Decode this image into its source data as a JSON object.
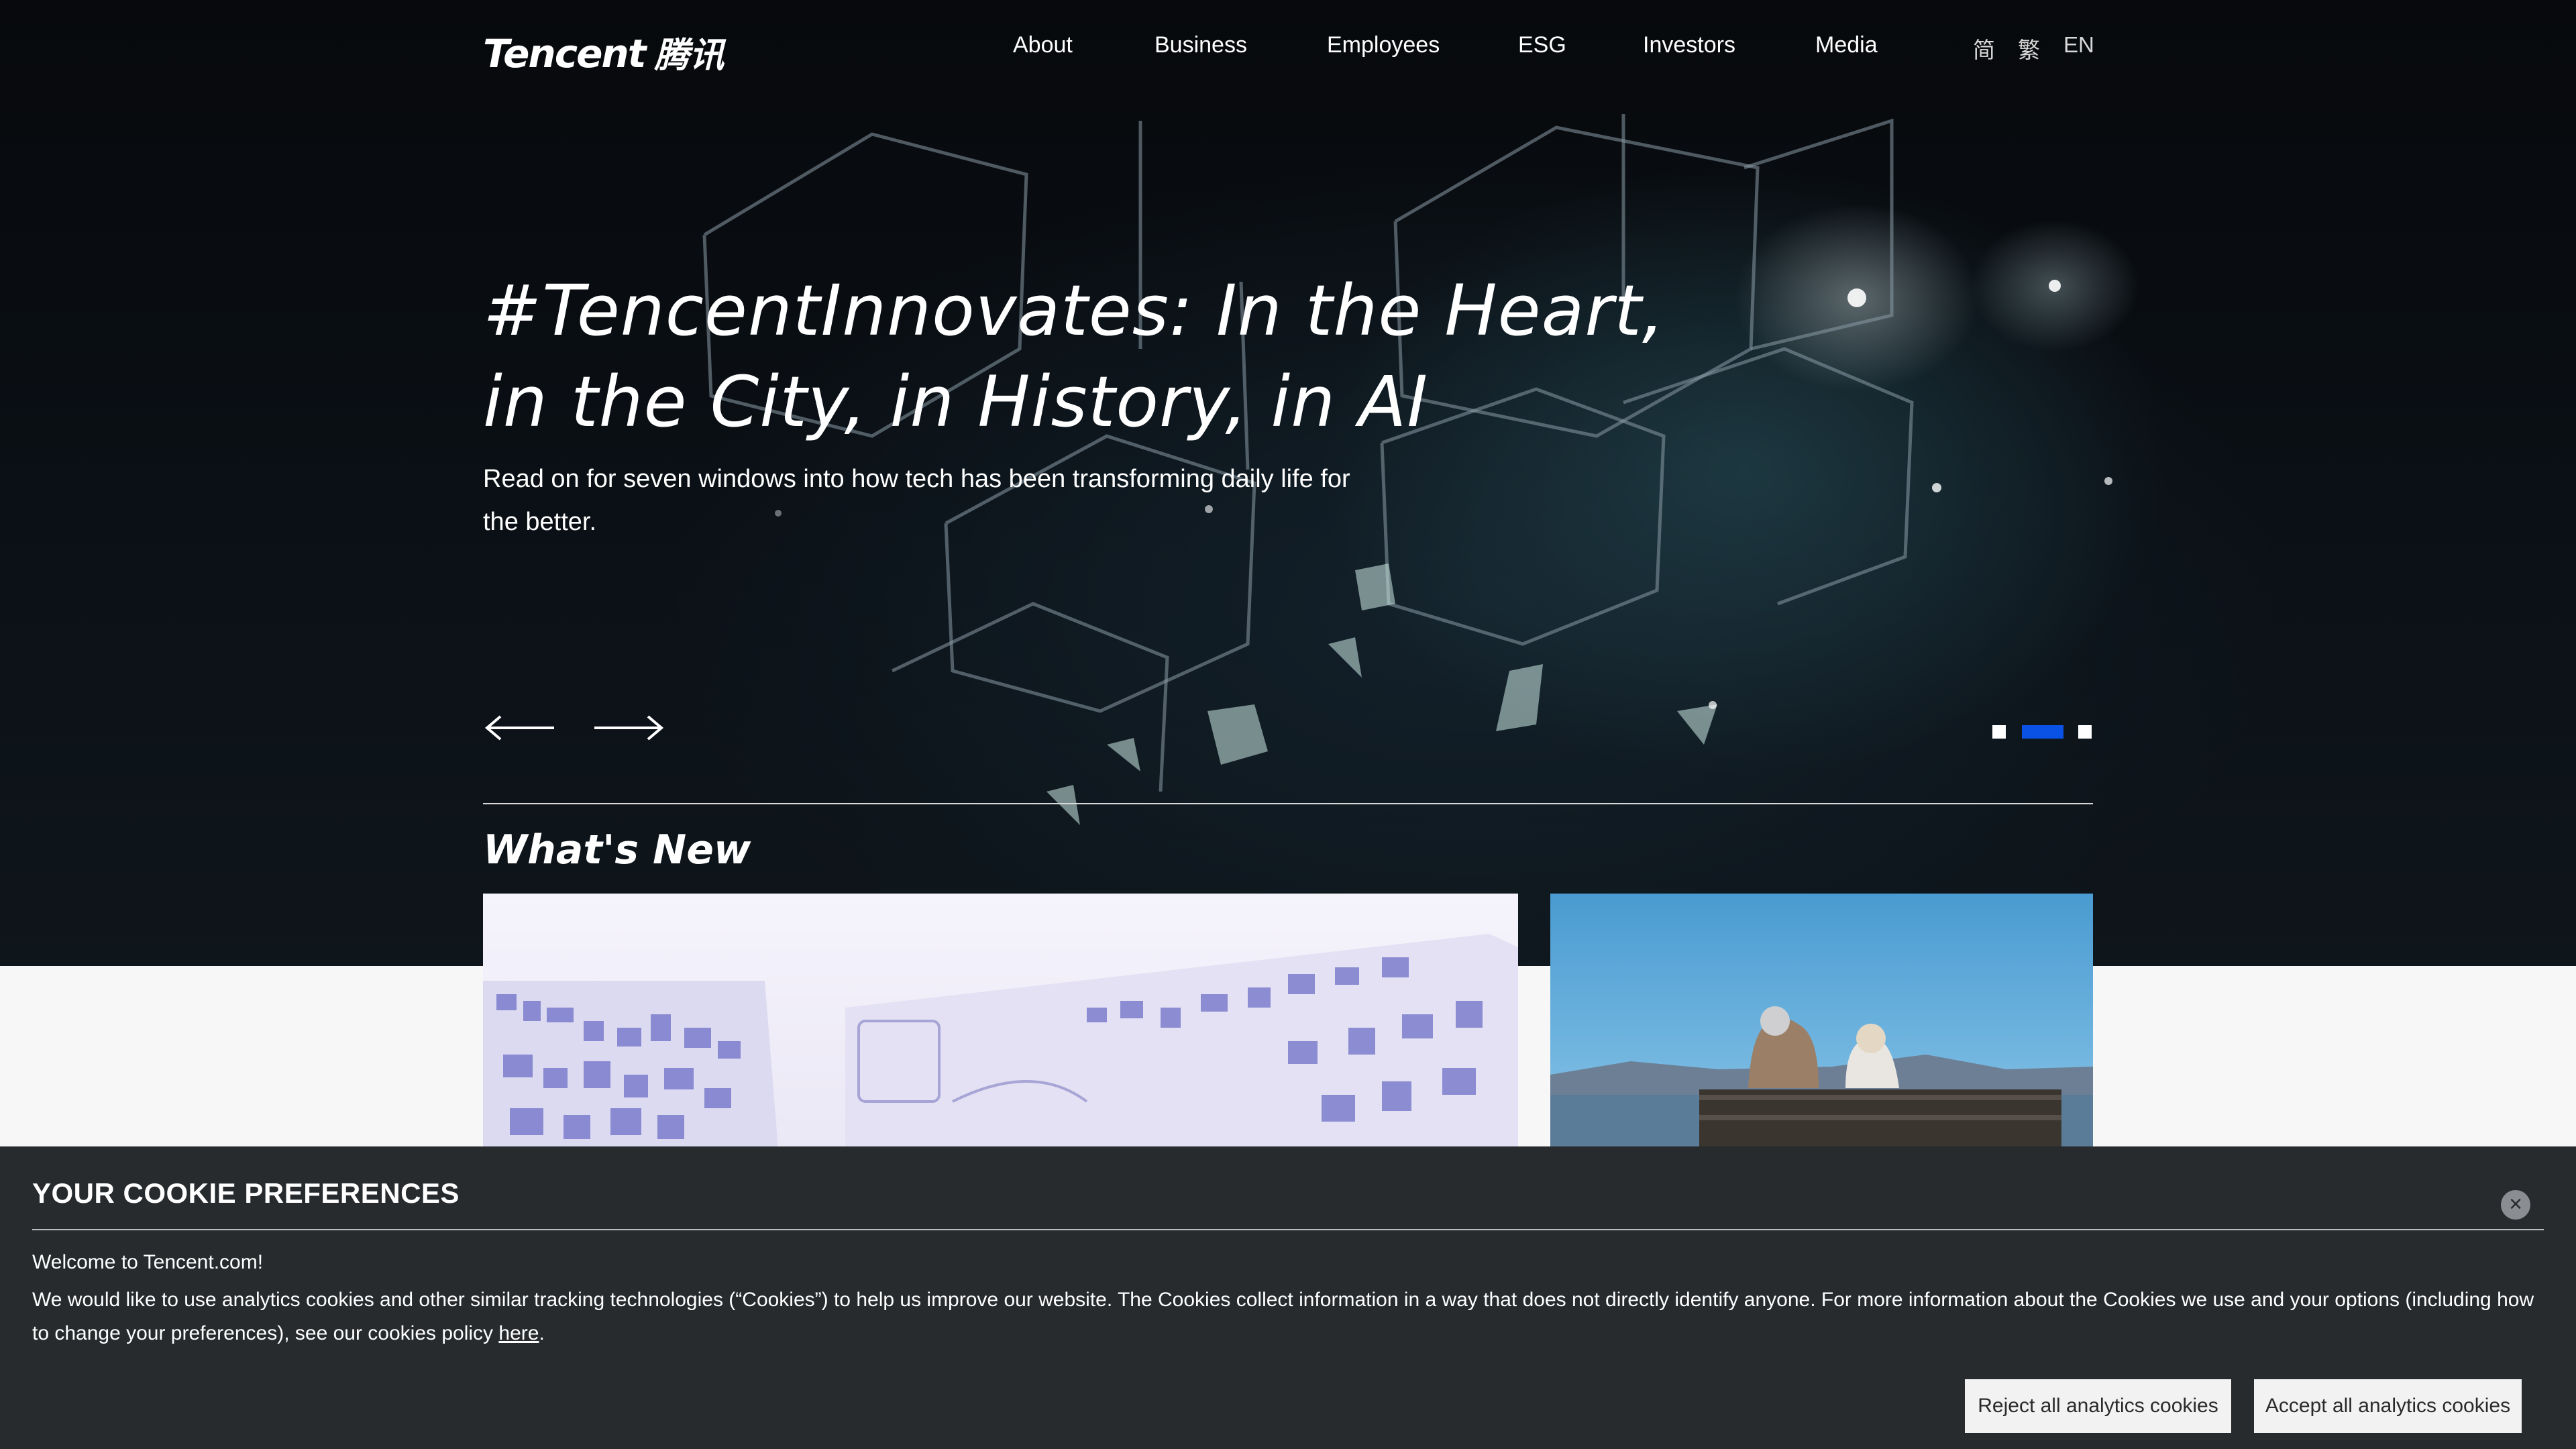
{
  "header": {
    "logo_en": "Tencent",
    "logo_zh": "腾讯",
    "nav": [
      {
        "label": "About"
      },
      {
        "label": "Business"
      },
      {
        "label": "Employees"
      },
      {
        "label": "ESG"
      },
      {
        "label": "Investors"
      },
      {
        "label": "Media"
      }
    ],
    "languages": [
      {
        "label": "简"
      },
      {
        "label": "繁"
      },
      {
        "label": "EN"
      }
    ]
  },
  "hero": {
    "headline": "#TencentInnovates: In the Heart, in the City, in History, in AI",
    "subline": "Read on for seven windows into how tech has been transforming daily life for the better.",
    "prev_icon": "arrow-left-icon",
    "next_icon": "arrow-right-icon",
    "slides_total": 3,
    "active_slide": 2,
    "accent_color": "#0a52e6"
  },
  "whats_new": {
    "title": "What's New"
  },
  "cookie_banner": {
    "title": "YOUR COOKIE PREFERENCES",
    "welcome": "Welcome to Tencent.com!",
    "text_before_link": "We would like to use analytics cookies and other similar tracking technologies (“Cookies”) to help us improve our website. The Cookies collect information in a way that does not directly identify anyone. For more information about the Cookies we use and your options (including how to change your preferences), see our cookies policy ",
    "link_text": "here",
    "text_after_link": ".",
    "close_icon": "close-icon",
    "reject_label": "Reject all analytics cookies",
    "accept_label": "Accept all analytics cookies",
    "background_color": "#272b2e"
  }
}
